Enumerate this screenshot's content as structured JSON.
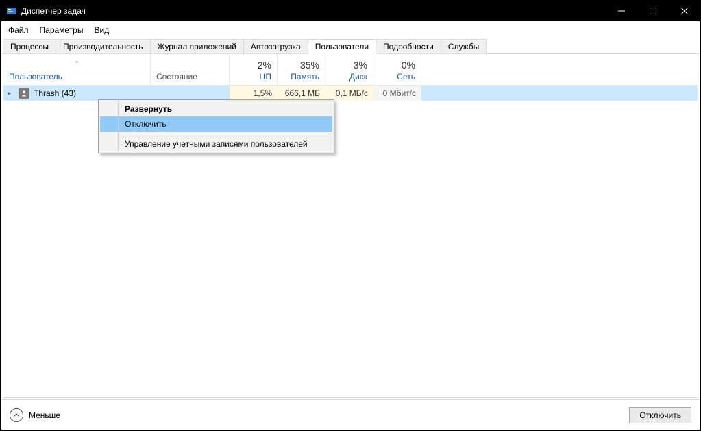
{
  "window": {
    "title": "Диспетчер задач"
  },
  "menu": {
    "file": "Файл",
    "options": "Параметры",
    "view": "Вид"
  },
  "tabs": {
    "processes": "Процессы",
    "performance": "Производительность",
    "apphistory": "Журнал приложений",
    "startup": "Автозагрузка",
    "users": "Пользователи",
    "details": "Подробности",
    "services": "Службы"
  },
  "columns": {
    "user": "Пользователь",
    "state": "Состояние",
    "cpu_pct": "2%",
    "cpu": "ЦП",
    "mem_pct": "35%",
    "mem": "Память",
    "disk_pct": "3%",
    "disk": "Диск",
    "net_pct": "0%",
    "net": "Сеть"
  },
  "row": {
    "user": "Thrash (43)",
    "cpu": "1,5%",
    "mem": "666,1 МБ",
    "disk": "0,1 МБ/с",
    "net": "0 Мбит/с"
  },
  "context_menu": {
    "expand": "Развернуть",
    "disconnect": "Отключить",
    "manage": "Управление учетными записями пользователей"
  },
  "footer": {
    "fewer": "Меньше",
    "disconnect": "Отключить"
  }
}
